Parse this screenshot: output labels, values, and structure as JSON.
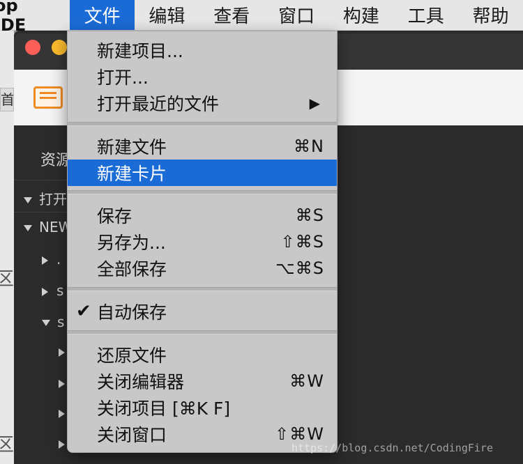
{
  "menubar": {
    "app_name": "op IDE",
    "menus": [
      "文件",
      "编辑",
      "查看",
      "窗口",
      "构建",
      "工具",
      "帮助"
    ],
    "active_menu": "文件"
  },
  "background_window": {
    "left_fragments": [
      "首",
      "区",
      "区"
    ],
    "sidebar_header": "资源",
    "tree": [
      "打开",
      "NEW",
      ".",
      "s",
      "s"
    ]
  },
  "file_menu": {
    "sections": [
      [
        {
          "label": "新建项目...",
          "shortcut": ""
        },
        {
          "label": "打开...",
          "shortcut": ""
        },
        {
          "label": "打开最近的文件",
          "shortcut": "",
          "submenu": true
        }
      ],
      [
        {
          "label": "新建文件",
          "shortcut": "⌘N"
        },
        {
          "label": "新建卡片",
          "shortcut": "",
          "highlighted": true
        }
      ],
      [
        {
          "label": "保存",
          "shortcut": "⌘S"
        },
        {
          "label": "另存为...",
          "shortcut": "⇧⌘S"
        },
        {
          "label": "全部保存",
          "shortcut": "⌥⌘S"
        }
      ],
      [
        {
          "label": "自动保存",
          "shortcut": "",
          "checked": true
        }
      ],
      [
        {
          "label": "还原文件",
          "shortcut": ""
        },
        {
          "label": "关闭编辑器",
          "shortcut": "⌘W"
        },
        {
          "label": "关闭项目 [⌘K F]",
          "shortcut": ""
        },
        {
          "label": "关闭窗口",
          "shortcut": "⇧⌘W"
        }
      ]
    ]
  },
  "icons": {
    "submenu_arrow": "triangle-right",
    "check": "checkmark",
    "toolbar": "folder-icon"
  },
  "colors": {
    "highlight": "#1b6bd7",
    "menu_bg": "#c8c8c8",
    "editor_bg": "#2b2b2b"
  },
  "watermark": "https://blog.csdn.net/CodingFire"
}
